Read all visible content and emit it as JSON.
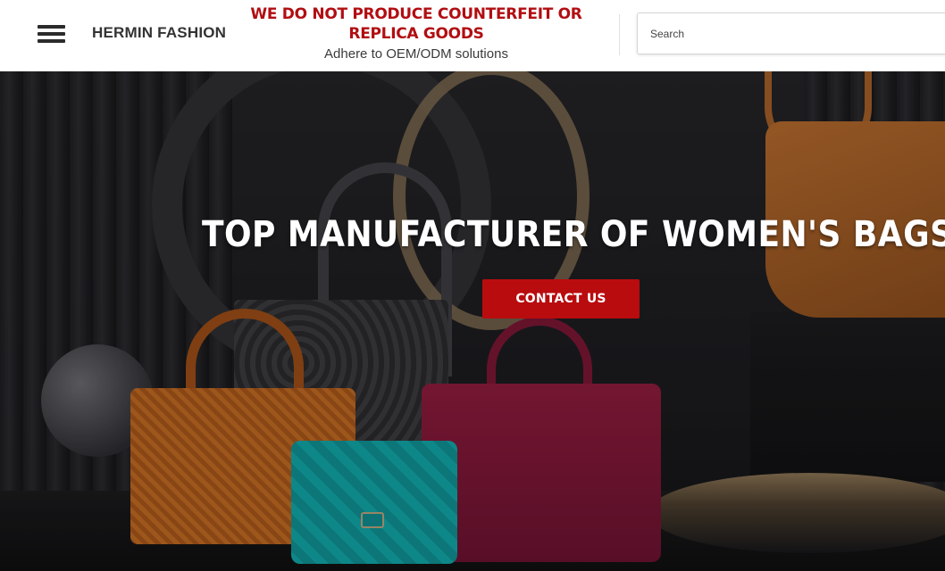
{
  "header": {
    "brand": "HERMIN FASHION",
    "notice_warning": "WE DO NOT PRODUCE COUNTERFEIT OR REPLICA GOODS",
    "notice_sub": "Adhere to OEM/ODM solutions",
    "search_placeholder": "Search",
    "menu_icon": "hamburger-menu-icon"
  },
  "hero": {
    "title": "TOP MANUFACTURER OF WOMEN'S BAGS",
    "cta_label": "CONTACT US"
  },
  "colors": {
    "accent": "#b90c0f",
    "warning_text": "#b10e12",
    "header_bg": "#ffffff"
  }
}
